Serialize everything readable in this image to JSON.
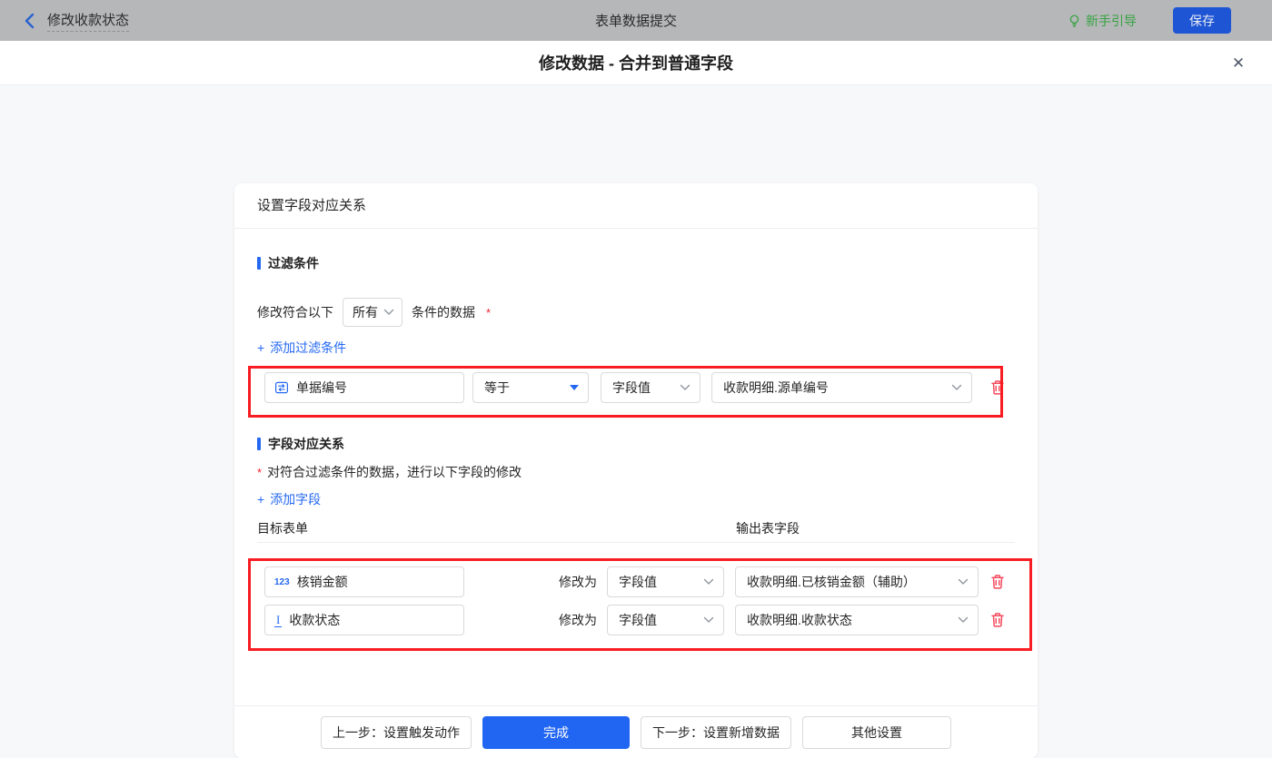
{
  "topbar": {
    "back_label": "修改收款状态",
    "center_title": "表单数据提交",
    "guide_label": "新手引导",
    "save_label": "保存"
  },
  "dialog": {
    "title": "修改数据 - 合并到普通字段",
    "close_glyph": "✕"
  },
  "panel": {
    "header": "设置字段对应关系",
    "filter": {
      "section_title": "过滤条件",
      "match_prefix": "修改符合以下",
      "match_value": "所有",
      "match_suffix": "条件的数据",
      "required_mark": "*",
      "add_icon": "+",
      "add_label": "添加过滤条件",
      "row": {
        "field": "单据编号",
        "operator": "等于",
        "value_type": "字段值",
        "value": "收款明细.源单编号"
      }
    },
    "mapping": {
      "section_title": "字段对应关系",
      "required_mark": "*",
      "description": "对符合过滤条件的数据，进行以下字段的修改",
      "add_icon": "+",
      "add_label": "添加字段",
      "columns": {
        "target": "目标表单",
        "output": "输出表字段"
      },
      "rows": [
        {
          "icon_glyph": "123",
          "field": "核销金额",
          "action": "修改为",
          "value_type": "字段值",
          "value": "收款明细.已核销金额（辅助）"
        },
        {
          "icon_glyph": "I",
          "field": "收款状态",
          "action": "修改为",
          "value_type": "字段值",
          "value": "收款明细.收款状态"
        }
      ]
    },
    "footer": {
      "prev": "上一步：设置触发动作",
      "done": "完成",
      "next": "下一步：设置新增数据",
      "other": "其他设置"
    }
  },
  "icons": {
    "back": "chevron-left",
    "guide": "lightbulb",
    "close": "close-x",
    "serial_field": "serial-number-icon",
    "number_field": "123-icon",
    "text_field": "text-icon",
    "delete": "trash-icon",
    "dropdown": "chevron-down",
    "operator_dropdown": "caret-down-filled"
  },
  "colors": {
    "accent_blue": "#2468f2",
    "link_blue": "#2468f2",
    "save_button_blue": "#1e55d5",
    "guide_green": "#35a341",
    "annotation_red": "#f81d22",
    "trash_red": "#f5475b",
    "asterisk_red": "#f5222d",
    "topbar_dimmed": "#b6b7b9"
  }
}
